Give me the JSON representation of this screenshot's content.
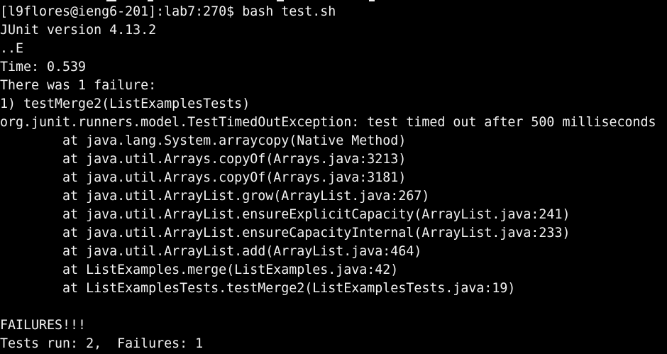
{
  "terminal": {
    "colors": {
      "background": "#000000",
      "foreground": "#f2f2f2"
    },
    "lines": [
      "[l9flores@ieng6-201]:lab7:270$ bash test.sh",
      "JUnit version 4.13.2",
      "..E",
      "Time: 0.539",
      "There was 1 failure:",
      "1) testMerge2(ListExamplesTests)",
      "org.junit.runners.model.TestTimedOutException: test timed out after 500 milliseconds",
      "        at java.lang.System.arraycopy(Native Method)",
      "        at java.util.Arrays.copyOf(Arrays.java:3213)",
      "        at java.util.Arrays.copyOf(Arrays.java:3181)",
      "        at java.util.ArrayList.grow(ArrayList.java:267)",
      "        at java.util.ArrayList.ensureExplicitCapacity(ArrayList.java:241)",
      "        at java.util.ArrayList.ensureCapacityInternal(ArrayList.java:233)",
      "        at java.util.ArrayList.add(ArrayList.java:464)",
      "        at ListExamples.merge(ListExamples.java:42)",
      "        at ListExamplesTests.testMerge2(ListExamplesTests.java:19)",
      "",
      "FAILURES!!!",
      "Tests run: 2,  Failures: 1"
    ]
  }
}
